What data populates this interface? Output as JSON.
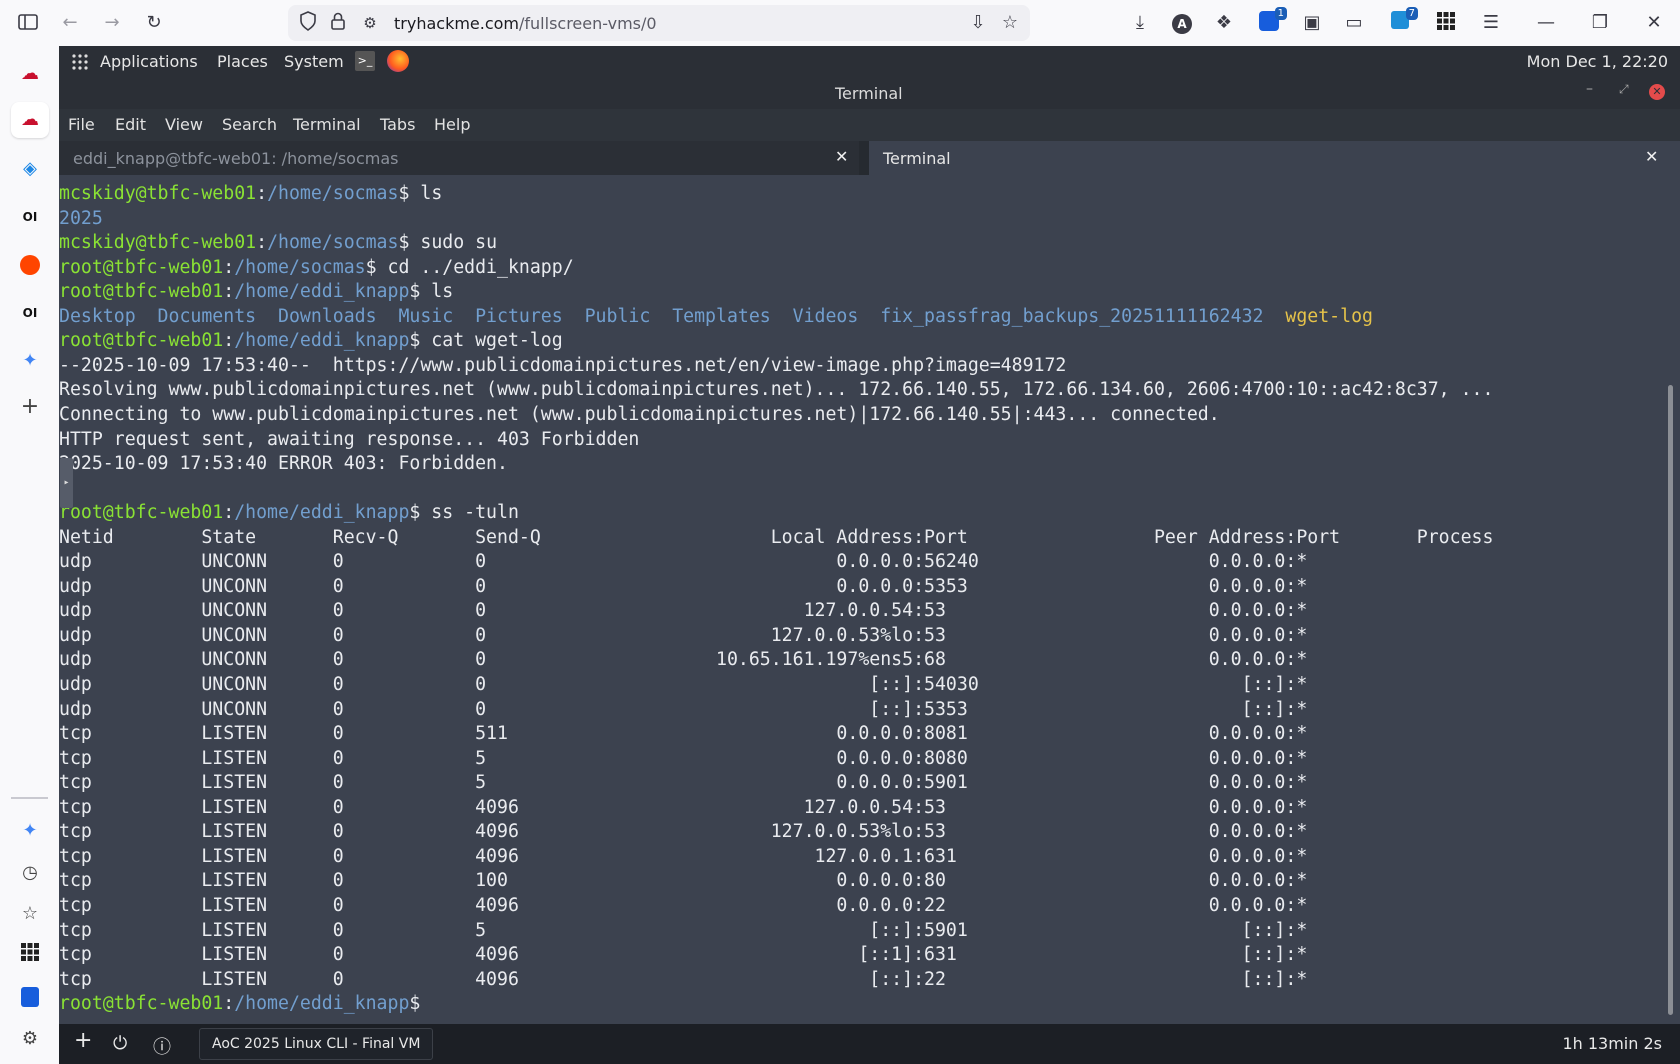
{
  "browser": {
    "url_host": "tryhackme.com",
    "url_path": "/fullscreen-vms/0",
    "extension_badge_1": "1",
    "extension_badge_2": "7"
  },
  "sidebar": {
    "items": [
      "tryhackme-icon",
      "tryhackme-active-icon",
      "layers-icon",
      "openai-icon",
      "reddit-icon",
      "openai-icon-2",
      "gemini-icon",
      "add-icon"
    ],
    "bottom_items": [
      "sparkle-icon",
      "history-icon",
      "bookmarks-icon",
      "apps-icon",
      "bitwarden-icon",
      "settings-icon"
    ]
  },
  "panel": {
    "applications": "Applications",
    "places": "Places",
    "system": "System",
    "clock": "Mon Dec  1, 22:20"
  },
  "terminal": {
    "window_title": "Terminal",
    "menu": [
      "File",
      "Edit",
      "View",
      "Search",
      "Terminal",
      "Tabs",
      "Help"
    ],
    "tabs": [
      {
        "label": "eddi_knapp@tbfc-web01: /home/socmas"
      },
      {
        "label": "Terminal"
      }
    ],
    "lines": [
      [
        {
          "t": "mcskidy@tbfc-web01",
          "c": "g"
        },
        {
          "t": ":",
          "c": "w"
        },
        {
          "t": "/home/socmas",
          "c": "b"
        },
        {
          "t": "$ ls",
          "c": "w"
        }
      ],
      [
        {
          "t": "2025",
          "c": "b"
        }
      ],
      [
        {
          "t": "mcskidy@tbfc-web01",
          "c": "g"
        },
        {
          "t": ":",
          "c": "w"
        },
        {
          "t": "/home/socmas",
          "c": "b"
        },
        {
          "t": "$ sudo su",
          "c": "w"
        }
      ],
      [
        {
          "t": "root@tbfc-web01",
          "c": "g"
        },
        {
          "t": ":",
          "c": "w"
        },
        {
          "t": "/home/socmas",
          "c": "b"
        },
        {
          "t": "$ cd ../eddi_knapp/",
          "c": "w"
        }
      ],
      [
        {
          "t": "root@tbfc-web01",
          "c": "g"
        },
        {
          "t": ":",
          "c": "w"
        },
        {
          "t": "/home/eddi_knapp",
          "c": "b"
        },
        {
          "t": "$ ls",
          "c": "w"
        }
      ],
      [
        {
          "t": "Desktop  Documents  Downloads  Music  Pictures  Public  Templates  Videos  fix_passfrag_backups_20251111162432",
          "c": "b"
        },
        {
          "t": "  wget-log",
          "c": "y"
        }
      ],
      [
        {
          "t": "root@tbfc-web01",
          "c": "g"
        },
        {
          "t": ":",
          "c": "w"
        },
        {
          "t": "/home/eddi_knapp",
          "c": "b"
        },
        {
          "t": "$ cat wget-log",
          "c": "w"
        }
      ],
      [
        {
          "t": "--2025-10-09 17:53:40--  https://www.publicdomainpictures.net/en/view-image.php?image=489172",
          "c": "w"
        }
      ],
      [
        {
          "t": "Resolving www.publicdomainpictures.net (www.publicdomainpictures.net)... 172.66.140.55, 172.66.134.60, 2606:4700:10::ac42:8c37, ...",
          "c": "w"
        }
      ],
      [
        {
          "t": "Connecting to www.publicdomainpictures.net (www.publicdomainpictures.net)|172.66.140.55|:443... connected.",
          "c": "w"
        }
      ],
      [
        {
          "t": "HTTP request sent, awaiting response... 403 Forbidden",
          "c": "w"
        }
      ],
      [
        {
          "t": "2025-10-09 17:53:40 ERROR 403: Forbidden.",
          "c": "w"
        }
      ],
      [
        {
          "t": "",
          "c": "w"
        }
      ],
      [
        {
          "t": "root@tbfc-web01",
          "c": "g"
        },
        {
          "t": ":",
          "c": "w"
        },
        {
          "t": "/home/eddi_knapp",
          "c": "b"
        },
        {
          "t": "$ ss -tuln",
          "c": "w"
        }
      ],
      [
        {
          "t": "Netid        State       Recv-Q       Send-Q                     Local Address:Port                 Peer Address:Port       Process",
          "c": "w"
        }
      ],
      [
        {
          "t": "udp          UNCONN      0            0                                0.0.0.0:56240                     0.0.0.0:*",
          "c": "w"
        }
      ],
      [
        {
          "t": "udp          UNCONN      0            0                                0.0.0.0:5353                      0.0.0.0:*",
          "c": "w"
        }
      ],
      [
        {
          "t": "udp          UNCONN      0            0                             127.0.0.54:53                        0.0.0.0:*",
          "c": "w"
        }
      ],
      [
        {
          "t": "udp          UNCONN      0            0                          127.0.0.53%lo:53                        0.0.0.0:*",
          "c": "w"
        }
      ],
      [
        {
          "t": "udp          UNCONN      0            0                     10.65.161.197%ens5:68                        0.0.0.0:*",
          "c": "w"
        }
      ],
      [
        {
          "t": "udp          UNCONN      0            0                                   [::]:54030                        [::]:*",
          "c": "w"
        }
      ],
      [
        {
          "t": "udp          UNCONN      0            0                                   [::]:5353                         [::]:*",
          "c": "w"
        }
      ],
      [
        {
          "t": "tcp          LISTEN      0            511                              0.0.0.0:8081                      0.0.0.0:*",
          "c": "w"
        }
      ],
      [
        {
          "t": "tcp          LISTEN      0            5                                0.0.0.0:8080                      0.0.0.0:*",
          "c": "w"
        }
      ],
      [
        {
          "t": "tcp          LISTEN      0            5                                0.0.0.0:5901                      0.0.0.0:*",
          "c": "w"
        }
      ],
      [
        {
          "t": "tcp          LISTEN      0            4096                          127.0.0.54:53                        0.0.0.0:*",
          "c": "w"
        }
      ],
      [
        {
          "t": "tcp          LISTEN      0            4096                       127.0.0.53%lo:53                        0.0.0.0:*",
          "c": "w"
        }
      ],
      [
        {
          "t": "tcp          LISTEN      0            4096                           127.0.0.1:631                       0.0.0.0:*",
          "c": "w"
        }
      ],
      [
        {
          "t": "tcp          LISTEN      0            100                              0.0.0.0:80                        0.0.0.0:*",
          "c": "w"
        }
      ],
      [
        {
          "t": "tcp          LISTEN      0            4096                             0.0.0.0:22                        0.0.0.0:*",
          "c": "w"
        }
      ],
      [
        {
          "t": "tcp          LISTEN      0            5                                   [::]:5901                         [::]:*",
          "c": "w"
        }
      ],
      [
        {
          "t": "tcp          LISTEN      0            4096                               [::1]:631                          [::]:*",
          "c": "w"
        }
      ],
      [
        {
          "t": "tcp          LISTEN      0            4096                                [::]:22                           [::]:*",
          "c": "w"
        }
      ],
      [
        {
          "t": "root@tbfc-web01",
          "c": "g"
        },
        {
          "t": ":",
          "c": "w"
        },
        {
          "t": "/home/eddi_knapp",
          "c": "b"
        },
        {
          "t": "$ ",
          "c": "w"
        }
      ]
    ]
  },
  "bottom_bar": {
    "vm_name": "AoC 2025 Linux CLI - Final VM",
    "timer": "1h 13min 2s"
  }
}
